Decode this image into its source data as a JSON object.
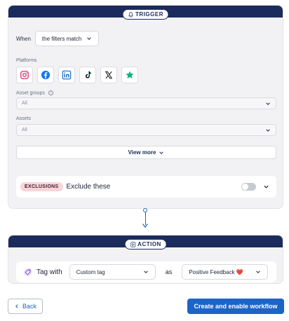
{
  "trigger": {
    "pill_label": "TRIGGER",
    "when_label": "When",
    "when_value": "the filters match",
    "platforms_label": "Platforms",
    "platforms": [
      {
        "name": "instagram",
        "icon": "instagram-icon",
        "color": "#e1306c"
      },
      {
        "name": "facebook",
        "icon": "facebook-icon",
        "color": "#1877f2"
      },
      {
        "name": "linkedin",
        "icon": "linkedin-icon",
        "color": "#0a66c2"
      },
      {
        "name": "tiktok",
        "icon": "tiktok-icon",
        "color": "#000000"
      },
      {
        "name": "x",
        "icon": "x-icon",
        "color": "#000000"
      },
      {
        "name": "trustpilot",
        "icon": "star-icon",
        "color": "#00b67a"
      }
    ],
    "asset_groups_label": "Asset groups",
    "asset_groups_value": "All",
    "assets_label": "Assets",
    "assets_value": "All",
    "view_more_label": "View more",
    "exclusions_badge": "EXCLUSIONS",
    "exclusions_text": "Exclude these",
    "exclusions_enabled": false
  },
  "action": {
    "pill_label": "ACTION",
    "tag_label": "Tag with",
    "tag_value": "Custom tag",
    "as_label": "as",
    "as_value": "Positive Feedback",
    "as_emoji": "❤️"
  },
  "footer": {
    "back_label": "Back",
    "create_label": "Create and enable workflow"
  },
  "colors": {
    "navy": "#1b2b5c",
    "primary": "#1b64c8",
    "exclusion_badge": "#f9d4d9"
  }
}
